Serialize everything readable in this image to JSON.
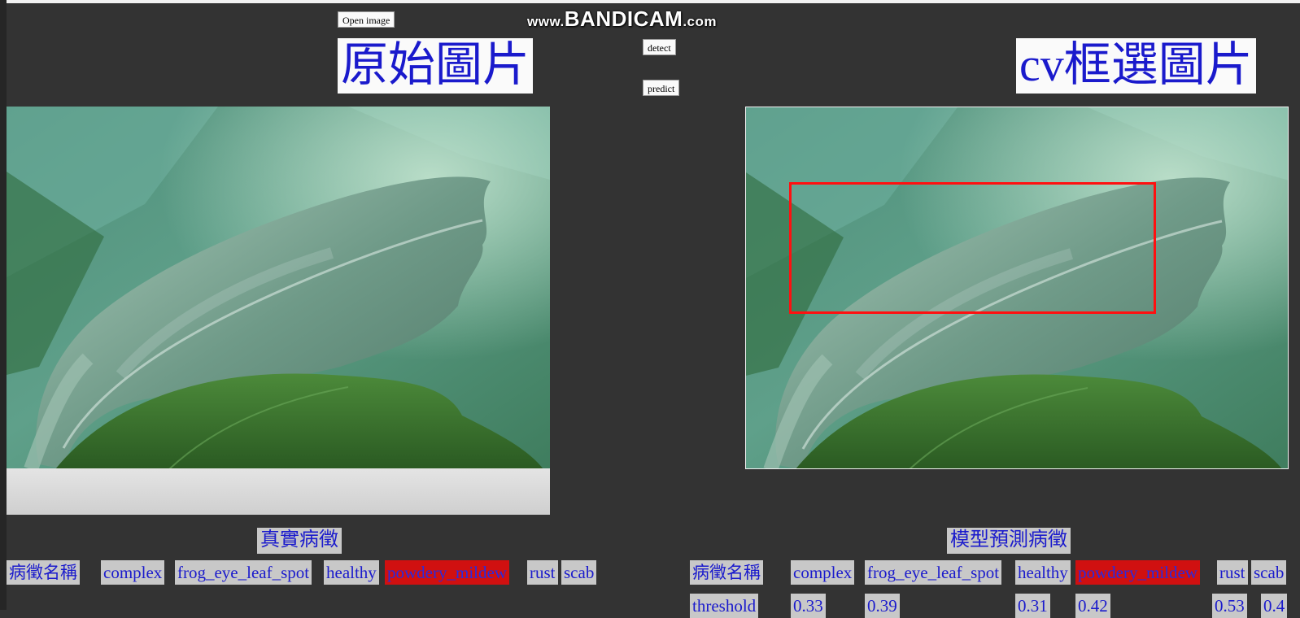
{
  "watermark": {
    "prefix": "www.",
    "brand": "BANDICAM",
    "suffix": ".com"
  },
  "toolbar": {
    "open_image_label": "Open image",
    "detect_label": "detect",
    "predict_label": "predict"
  },
  "left_panel": {
    "title": "原始圖片"
  },
  "right_panel": {
    "title": "cv框選圖片"
  },
  "real_section": {
    "heading": "真實病徵",
    "row_label": "病徵名稱",
    "classes": [
      "complex",
      "frog_eye_leaf_spot",
      "healthy",
      "powdery_mildew",
      "rust",
      "scab"
    ],
    "highlighted_class": "powdery_mildew"
  },
  "pred_section": {
    "heading": "模型預測病徵",
    "row_label": "病徵名稱",
    "classes": [
      "complex",
      "frog_eye_leaf_spot",
      "healthy",
      "powdery_mildew",
      "rust",
      "scab"
    ],
    "highlighted_class": "powdery_mildew",
    "threshold_label": "threshold",
    "thresholds": [
      "0.33",
      "0.39",
      "0.31",
      "0.42",
      "0.53",
      "0.4"
    ]
  },
  "colors": {
    "background": "#333333",
    "label_text": "#1a1acc",
    "label_bg": "#c8c8c8",
    "highlight": "#d01010",
    "bbox": "#ff1010"
  }
}
